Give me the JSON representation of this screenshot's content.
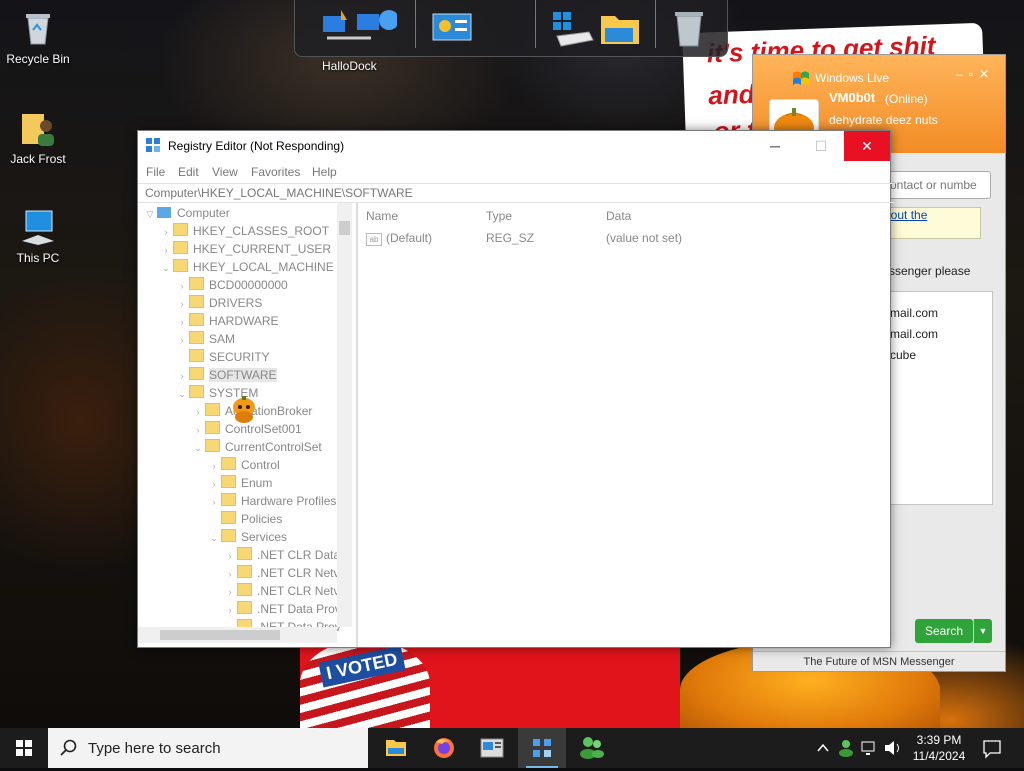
{
  "desktop": {
    "icons": [
      {
        "label": "Recycle Bin"
      },
      {
        "label": "Jack Frost"
      },
      {
        "label": "This PC"
      }
    ],
    "wallpaper_text": {
      "line1": "it's time to get shit",
      "line2": "and",
      "line3": "or t"
    },
    "voted_sticker": "I VOTED"
  },
  "dock": {
    "label": "HalloDock",
    "items": [
      "network-icon",
      "control-panel-icon",
      "drive-icon",
      "file-explorer-icon",
      "recycle-bin-icon"
    ]
  },
  "msn": {
    "title": "Windows Live",
    "username": "VM0b0t",
    "status": "(Online)",
    "personal_message": "dehydrate deez nuts",
    "search_placeholder": "ontact or numbe",
    "notice_line1": "bout the",
    "notice_line2": "e",
    "message": "ssenger please",
    "contacts": [
      "mail.com",
      "mail.com",
      "cube"
    ],
    "search_button": "Search",
    "footer": "The Future of MSN Messenger"
  },
  "registry": {
    "title": "Registry Editor (Not Responding)",
    "menu": [
      "File",
      "Edit",
      "View",
      "Favorites",
      "Help"
    ],
    "address": "Computer\\HKEY_LOCAL_MACHINE\\SOFTWARE",
    "tree": {
      "computer": "Computer",
      "hkcr": "HKEY_CLASSES_ROOT",
      "hkcu": "HKEY_CURRENT_USER",
      "hklm": "HKEY_LOCAL_MACHINE",
      "bcd": "BCD00000000",
      "drivers": "DRIVERS",
      "hardware": "HARDWARE",
      "sam": "SAM",
      "security": "SECURITY",
      "software": "SOFTWARE",
      "system": "SYSTEM",
      "activation": "ActivationBroker",
      "cs001": "ControlSet001",
      "ccs": "CurrentControlSet",
      "control": "Control",
      "enum": "Enum",
      "hwprofiles": "Hardware Profiles",
      "policies": "Policies",
      "services": "Services",
      "svc": [
        ".NET CLR Data",
        ".NET CLR Netv",
        ".NET CLR Netv",
        ".NET Data Prov",
        ".NET Data Prov"
      ]
    },
    "columns": {
      "name": "Name",
      "type": "Type",
      "data": "Data"
    },
    "row": {
      "name": "(Default)",
      "type": "REG_SZ",
      "data": "(value not set)"
    }
  },
  "taskbar": {
    "search_placeholder": "Type here to search",
    "time": "3:39 PM",
    "date": "11/4/2024"
  }
}
